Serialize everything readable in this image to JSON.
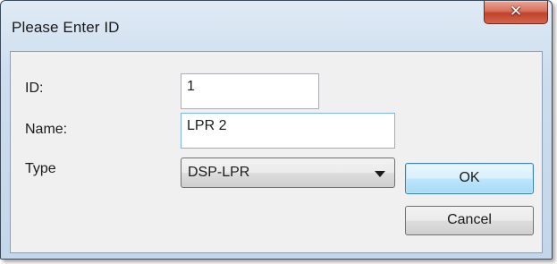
{
  "dialog": {
    "title": "Please Enter ID",
    "close_icon": "✕"
  },
  "form": {
    "id_label": "ID:",
    "id_value": "1",
    "name_label": "Name:",
    "name_value": "LPR 2",
    "type_label": "Type",
    "type_value": "DSP-LPR"
  },
  "buttons": {
    "ok_label": "OK",
    "cancel_label": "Cancel"
  },
  "icons": {
    "close": "close-icon",
    "dropdown": "chevron-down-icon"
  },
  "colors": {
    "close_button": "#c8503a",
    "default_button_border": "#3c7fb1",
    "client_background": "#f0f0f0",
    "title_background": "#cfdeee"
  }
}
